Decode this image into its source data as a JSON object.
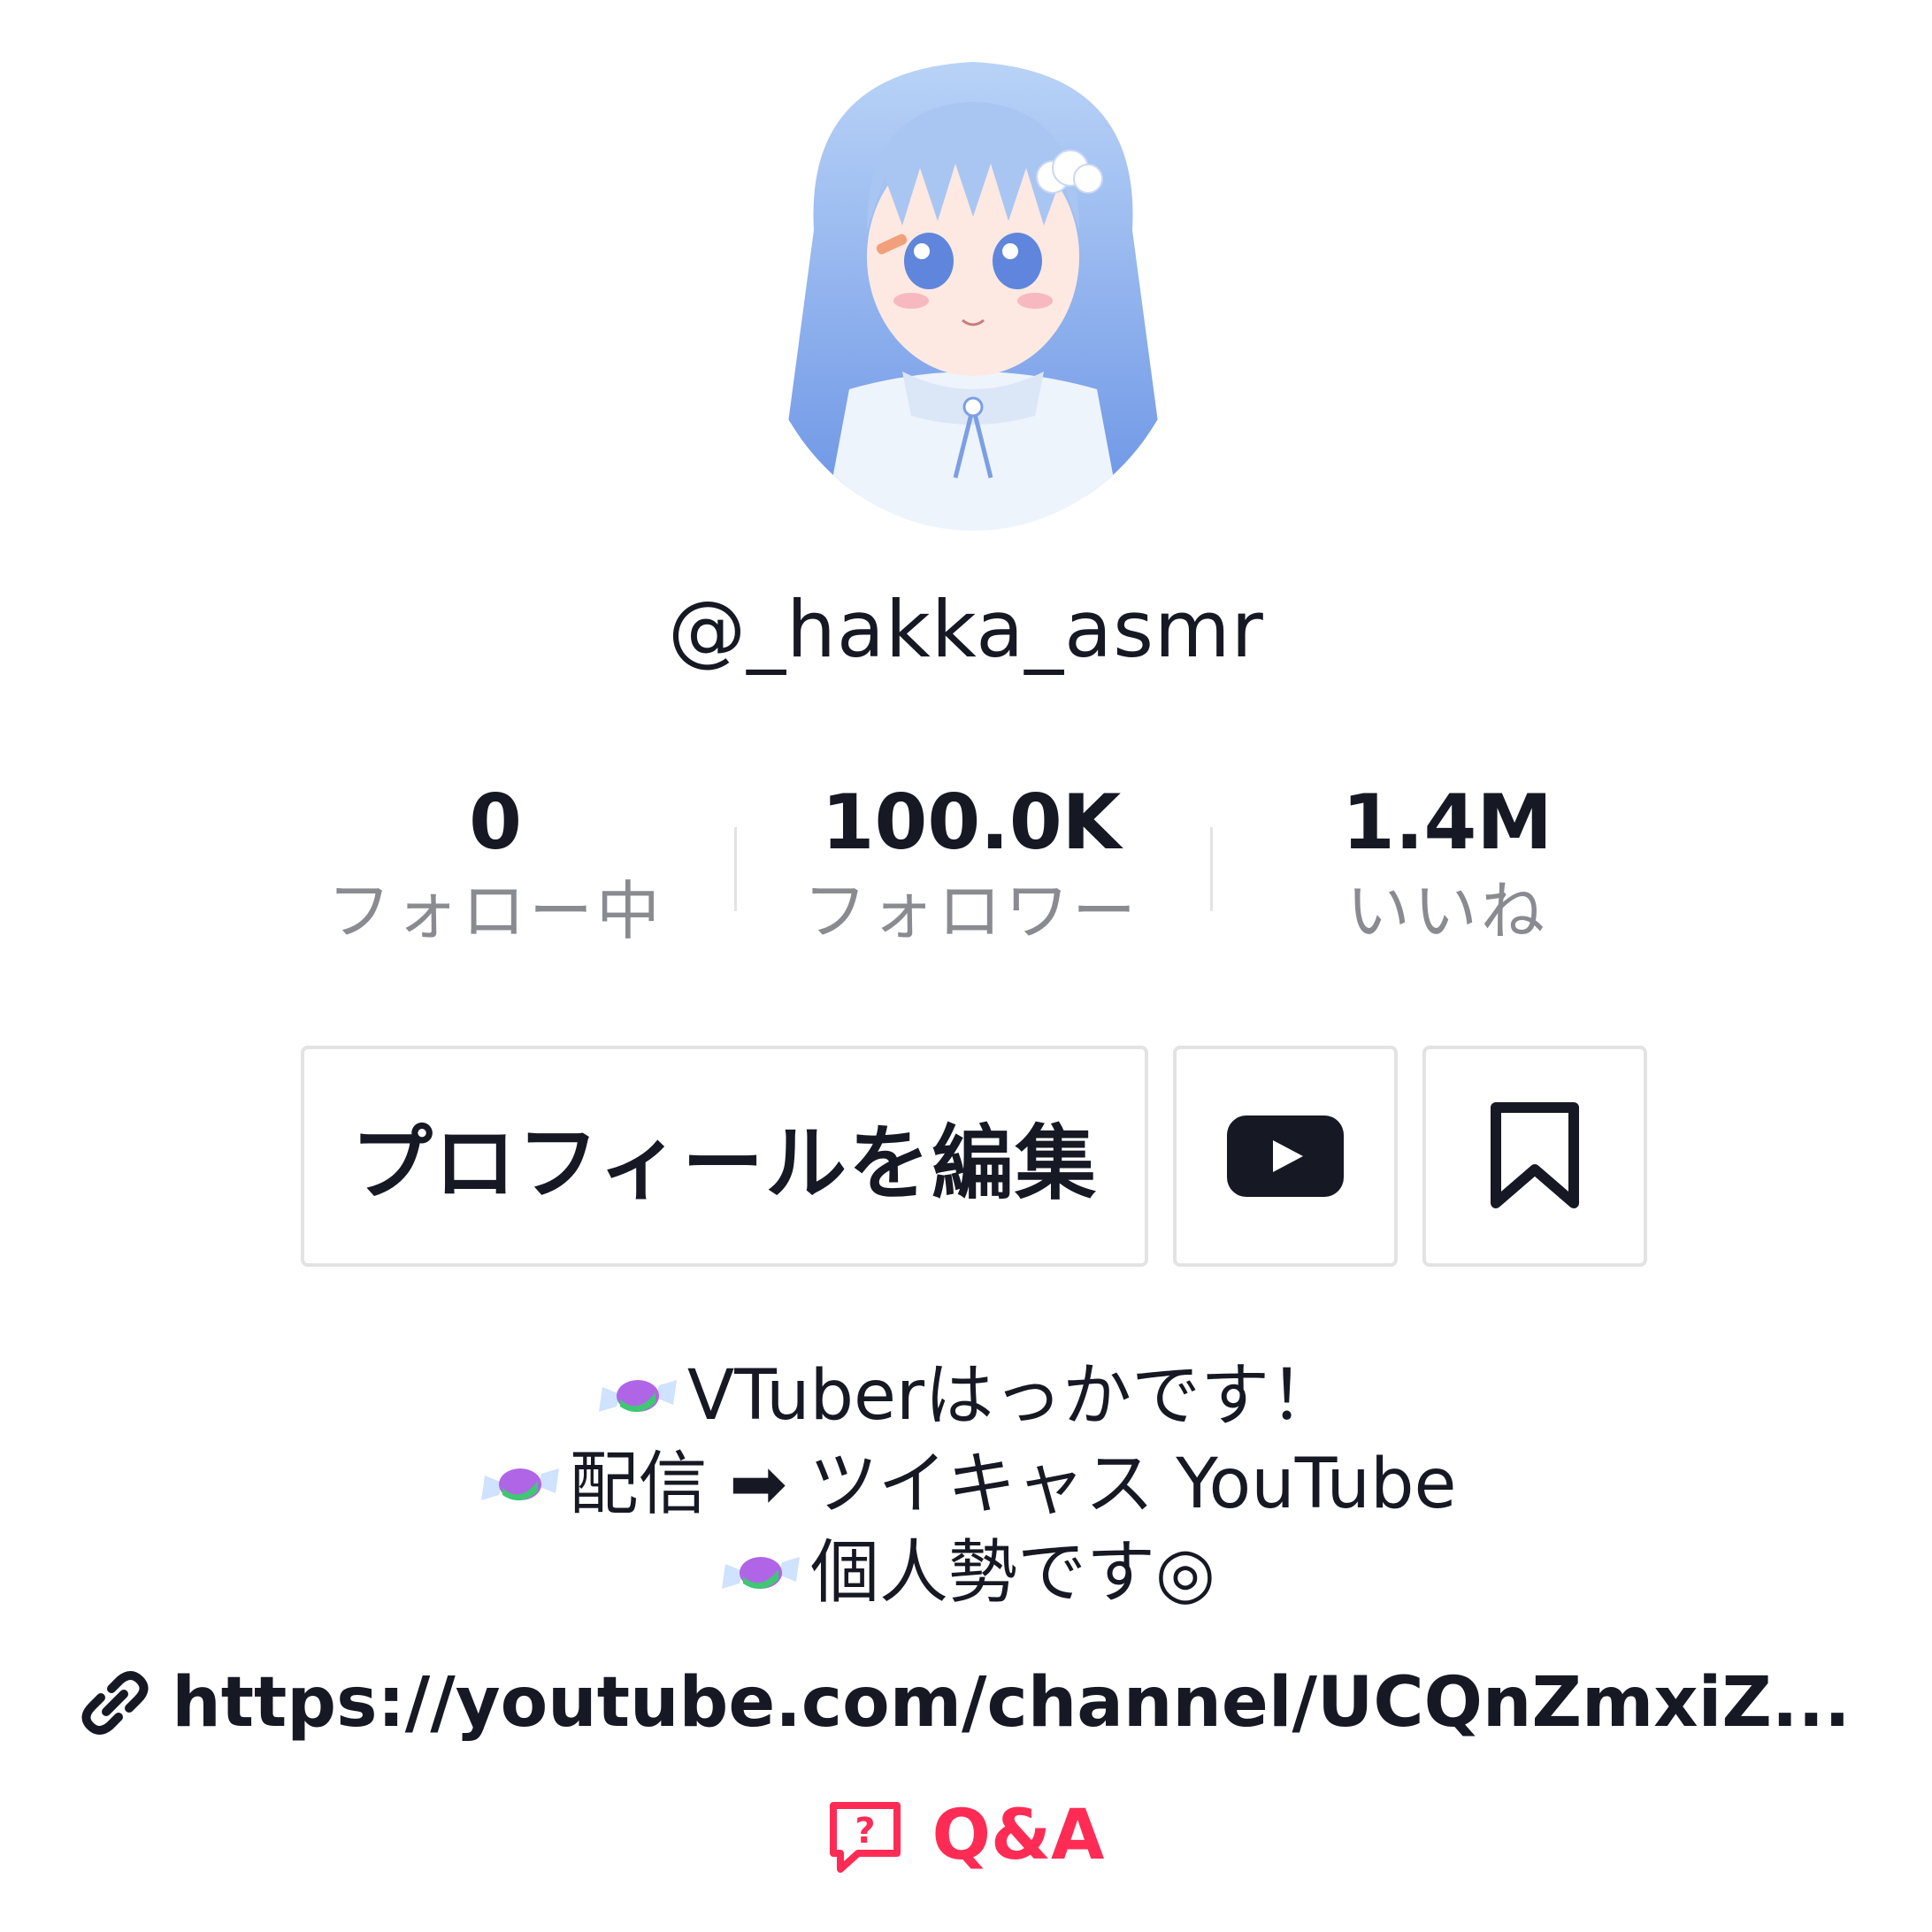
{
  "profile": {
    "username": "@_hakka_asmr",
    "avatar": "anime-girl-avatar"
  },
  "stats": [
    {
      "value": "0",
      "label": "フォロー中"
    },
    {
      "value": "100.0K",
      "label": "フォロワー"
    },
    {
      "value": "1.4M",
      "label": "いいね"
    }
  ],
  "actions": {
    "edit_profile_label": "プロフィールを編集",
    "youtube_icon": "youtube-icon",
    "bookmark_icon": "bookmark-icon"
  },
  "bio": {
    "line1": "VTuberはっかです！",
    "line2": "配信 ➡ ツイキャス YouTube",
    "line3": "個人勢です◎",
    "bullet_icon": "candy-icon"
  },
  "link": {
    "text": "https://youtube.com/channel/UCQnZmxiZ..."
  },
  "qa": {
    "label": "Q&A"
  },
  "colors": {
    "text": "#161823",
    "muted": "#8a8b91",
    "border": "#e3e3e4",
    "accent": "#fe2c55"
  }
}
